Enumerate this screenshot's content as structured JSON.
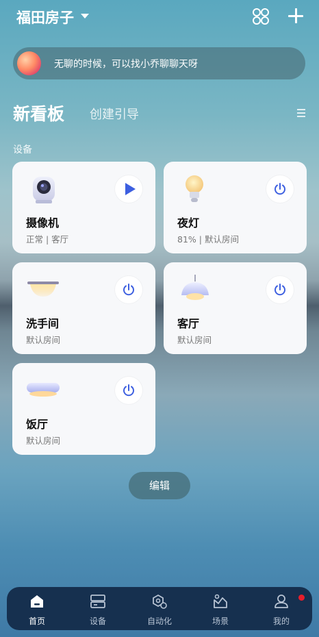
{
  "header": {
    "home_name": "福田房子"
  },
  "assistant": {
    "text": "无聊的时候，可以找小乔聊聊天呀"
  },
  "board": {
    "title": "新看板",
    "guide_label": "创建引导"
  },
  "section_title": "设备",
  "devices": [
    {
      "name": "摄像机",
      "status": "正常 | 客厅",
      "control": "play"
    },
    {
      "name": "夜灯",
      "status": "81% | 默认房间",
      "control": "power"
    },
    {
      "name": "洗手间",
      "status": "默认房间",
      "control": "power"
    },
    {
      "name": "客厅",
      "status": "默认房间",
      "control": "power"
    },
    {
      "name": "饭厅",
      "status": "默认房间",
      "control": "power"
    }
  ],
  "edit_label": "编辑",
  "tabbar": {
    "tabs": [
      {
        "label": "首页",
        "icon": "home-icon",
        "active": true
      },
      {
        "label": "设备",
        "icon": "devices-icon",
        "active": false
      },
      {
        "label": "自动化",
        "icon": "automation-icon",
        "active": false
      },
      {
        "label": "场景",
        "icon": "scene-icon",
        "active": false
      },
      {
        "label": "我的",
        "icon": "profile-icon",
        "active": false
      }
    ]
  },
  "colors": {
    "accent": "#3d5fe0",
    "badge": "#e81e2b",
    "tabbar_bg": "#16304f"
  }
}
